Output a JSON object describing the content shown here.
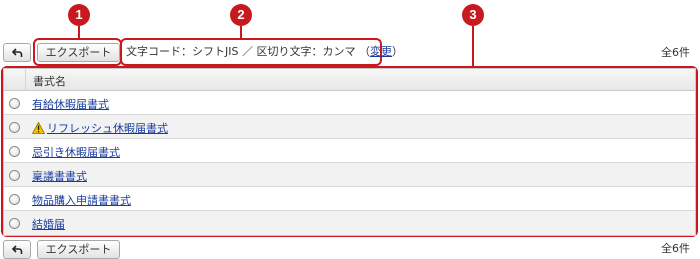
{
  "callouts": [
    "1",
    "2",
    "3"
  ],
  "toolbar": {
    "back_icon": "back-arrow-icon",
    "export_label": "エクスポート",
    "encoding_text": "文字コード：シフトJIS ／ 区切り文字：カンマ （",
    "change_link": "変更",
    "encoding_close": "）",
    "total_count": "全6件"
  },
  "table": {
    "header": "書式名",
    "rows": [
      {
        "label": "有給休暇届書式",
        "warning": false
      },
      {
        "label": "リフレッシュ休暇届書式",
        "warning": true
      },
      {
        "label": "忌引き休暇届書式",
        "warning": false
      },
      {
        "label": "稟議書書式",
        "warning": false
      },
      {
        "label": "物品購入申請書書式",
        "warning": false
      },
      {
        "label": "結婚届",
        "warning": false
      }
    ]
  },
  "colors": {
    "accent_red": "#c8191f",
    "link": "#1a3c9e",
    "warning_yellow": "#f5c400"
  }
}
